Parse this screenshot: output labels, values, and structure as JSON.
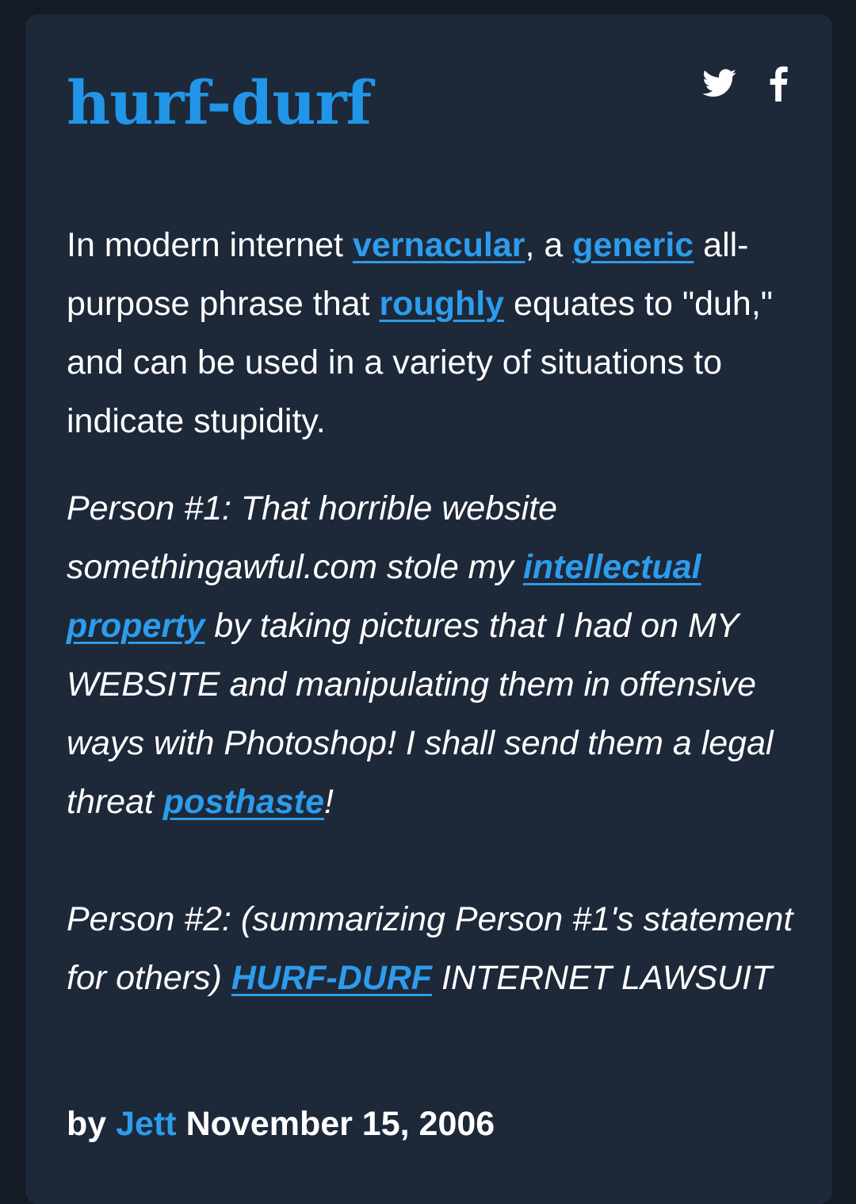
{
  "entry": {
    "word": "hurf-durf",
    "share": {
      "twitter_icon": "twitter-icon",
      "facebook_icon": "facebook-icon"
    },
    "meaning": {
      "t1": "In modern internet ",
      "link1": "vernacular",
      "t2": ", a ",
      "link2": "generic",
      "t3": " all-purpose phrase that ",
      "link3": "roughly",
      "t4": " equates to \"duh,\" and can be used in a variety of situations to indicate stupidity."
    },
    "example": {
      "t1": "Person #1: That horrible website somethingawful.com stole my ",
      "link1": "intellectual property",
      "t2": " by taking pictures that I had on MY WEBSITE and manipulating them in offensive ways with Photoshop! I shall send them a legal threat ",
      "link2": "posthaste",
      "t3": "!",
      "t4": "Person #2: (summarizing Person #1's statement for others) ",
      "link3": "HURF-DURF",
      "t5": " INTERNET LAWSUIT"
    },
    "byline": {
      "prefix": "by",
      "author": "Jett",
      "date": "November 15, 2006"
    }
  },
  "colors": {
    "background": "#141b26",
    "card": "#1d2839",
    "accent": "#2196e8",
    "link": "#2d9cec",
    "text": "#ffffff"
  }
}
